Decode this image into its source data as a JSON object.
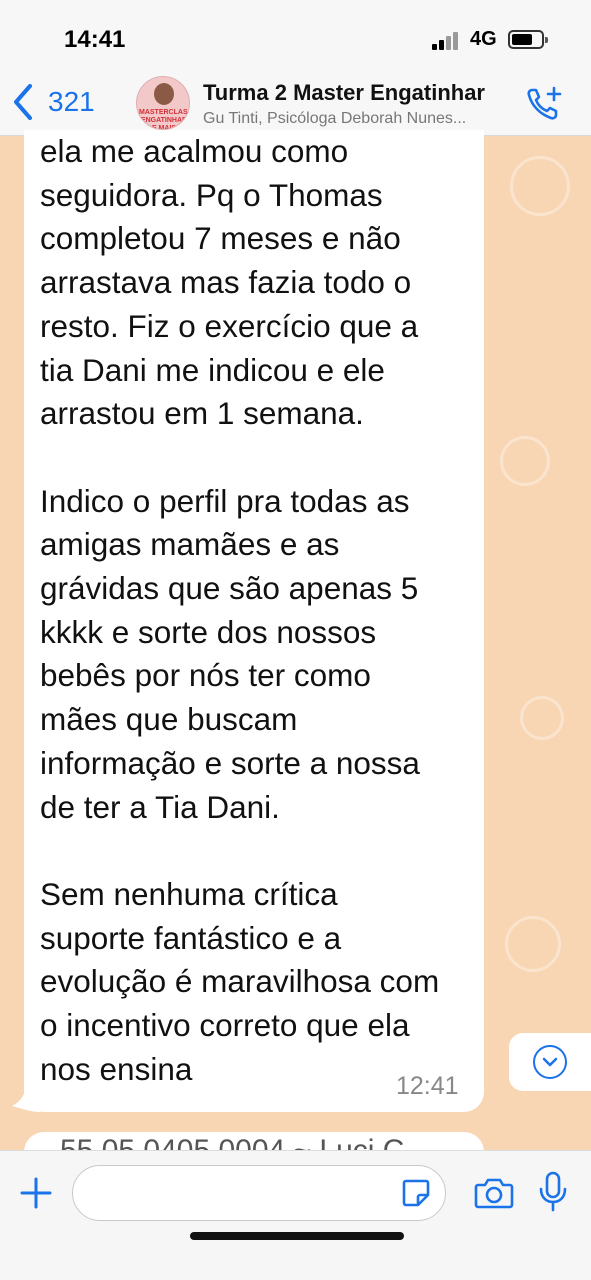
{
  "status_bar": {
    "time": "14:41",
    "network": "4G"
  },
  "header": {
    "back_count": "321",
    "group_name": "Turma 2 Master Engatinhar",
    "participants": "Gu Tinti, Psicóloga Deborah Nunes...",
    "avatar_text": "MASTERCLASS ENGATINHAR E MAIS"
  },
  "message": {
    "text": "ela me acalmou como\nseguidora. Pq o Thomas\ncompletou 7 meses e não\narrastava mas fazia todo o\nresto. Fiz o exercício que a\ntia Dani me indicou e ele\narrastou em 1 semana.\n\nIndico o perfil pra todas as\namigas mamães e as\ngrávidas que são apenas 5\nkkkk e sorte dos nossos\nbebês por nós ter como\nmães que buscam\ninformação e sorte a nossa\nde ter a Tia Dani.\n\nSem nenhuma crítica\nsuporte fantástico e a\nevolução é maravilhosa com\no incentivo correto que ela\nnos ensina",
    "time": "12:41"
  },
  "next_message": {
    "partial_text": "55 05 0405 0004   ~ Luci C"
  },
  "input": {
    "placeholder": ""
  },
  "colors": {
    "accent": "#1a73e8",
    "wallpaper": "#f8d6b4",
    "bubble": "#ffffff"
  }
}
